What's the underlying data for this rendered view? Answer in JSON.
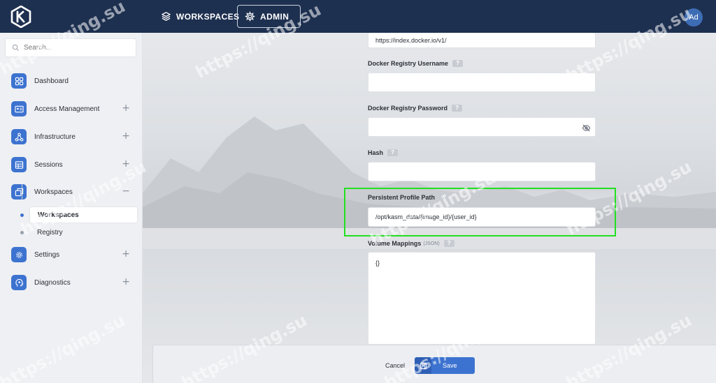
{
  "topbar": {
    "nav": [
      {
        "label": "WORKSPACES",
        "icon": "layers-icon"
      },
      {
        "label": "ADMIN",
        "icon": "gear-icon"
      }
    ],
    "avatar": "Ad"
  },
  "sidebar": {
    "search_placeholder": "Search...",
    "items": [
      {
        "label": "Dashboard",
        "icon": "dashboard-icon",
        "expand": ""
      },
      {
        "label": "Access Management",
        "icon": "id-card-icon",
        "expand": "+"
      },
      {
        "label": "Infrastructure",
        "icon": "network-icon",
        "expand": "+"
      },
      {
        "label": "Sessions",
        "icon": "table-icon",
        "expand": "+"
      },
      {
        "label": "Workspaces",
        "icon": "windows-icon",
        "expand": "−"
      },
      {
        "label": "Settings",
        "icon": "gear-icon",
        "expand": "+"
      },
      {
        "label": "Diagnostics",
        "icon": "head-icon",
        "expand": "+"
      }
    ],
    "sub_items": [
      {
        "label": "Workspaces",
        "active": true
      },
      {
        "label": "Registry",
        "active": false
      }
    ]
  },
  "form": {
    "registry_url_value": "https://index.docker.io/v1/",
    "username_label": "Docker Registry Username",
    "username_value": "",
    "password_label": "Docker Registry Password",
    "password_value": "",
    "hash_label": "Hash",
    "hash_value": "",
    "profile_path_label": "Persistent Profile Path",
    "profile_path_value": "/opt/kasm_data/{image_id}/{user_id}",
    "volume_label": "Volume Mappings",
    "volume_hint": "(JSON)",
    "volume_value": "{}",
    "help": "?"
  },
  "footer": {
    "cancel": "Cancel",
    "save": "Save"
  },
  "watermark": "https://qing.su",
  "colors": {
    "topbar": "#1e3050",
    "accent": "#3d73d0",
    "highlight": "#22e01f"
  }
}
